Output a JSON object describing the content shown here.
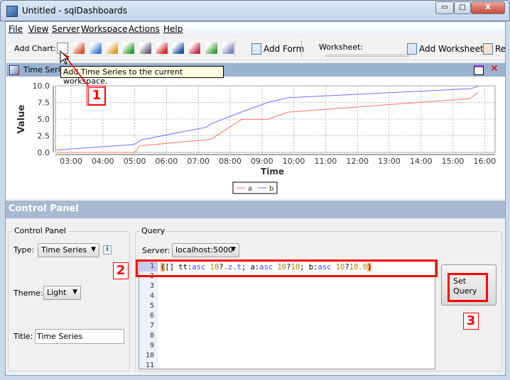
{
  "window": {
    "title": "Untitled - sqlDashboards",
    "min": "▭",
    "max": "□",
    "close": "X"
  },
  "menu": [
    "File",
    "View",
    "Server",
    "Workspace",
    "Actions",
    "Help"
  ],
  "toolbar": {
    "add_chart_label": "Add Chart:",
    "chart_icons": [
      "time-series-icon",
      "area-chart-icon",
      "bar-chart-icon",
      "bubble-chart-icon",
      "candlestick-icon",
      "table-icon",
      "heatmap-icon",
      "histogram-icon",
      "line-chart-icon",
      "pie-chart-icon",
      "scatter-icon"
    ],
    "add_form": "Add Form",
    "worksheet_label": "Worksheet:",
    "add_worksheet": "Add Worksheet",
    "remove": "Rem"
  },
  "tooltip": "Add Time Series to the current workspace.",
  "internal_frame": {
    "title": "Time Series"
  },
  "annotations": [
    "1",
    "2",
    "3"
  ],
  "chart_data": {
    "type": "line",
    "xlabel": "Time",
    "ylabel": "Value",
    "ylim": [
      0,
      10
    ],
    "yticks": [
      "0.0",
      "2.5",
      "5.0",
      "7.5",
      "10.0"
    ],
    "xticks": [
      "03:00",
      "04:00",
      "05:00",
      "06:00",
      "07:00",
      "08:00",
      "09:00",
      "10:00",
      "11:00",
      "12:00",
      "13:00",
      "14:00",
      "15:00",
      "16:00"
    ],
    "grid": true,
    "legend": "bottom",
    "series": [
      {
        "name": "a",
        "color": "#ff7070",
        "points": [
          [
            "02:33",
            0
          ],
          [
            "05:00",
            0
          ],
          [
            "05:10",
            1.0
          ],
          [
            "07:23",
            1.96
          ],
          [
            "08:22",
            4.96
          ],
          [
            "09:11",
            4.96
          ],
          [
            "09:48",
            6.04
          ],
          [
            "15:32",
            8.07
          ],
          [
            "15:48",
            9.04
          ]
        ]
      },
      {
        "name": "b",
        "color": "#7070ff",
        "points": [
          [
            "02:33",
            0.36
          ],
          [
            "05:00",
            1.2
          ],
          [
            "05:11",
            1.86
          ],
          [
            "07:15",
            3.79
          ],
          [
            "07:23",
            4.25
          ],
          [
            "08:19",
            6.0
          ],
          [
            "09:11",
            7.5
          ],
          [
            "09:48",
            8.2
          ],
          [
            "15:34",
            9.57
          ],
          [
            "15:48",
            9.93
          ]
        ]
      }
    ]
  },
  "control_panel": {
    "header": "Control Panel",
    "group_title": "Control Panel",
    "type_label": "Type:",
    "type_value": "Time Series",
    "theme_label": "Theme:",
    "theme_value": "Light",
    "title_label": "Title:",
    "title_value": "Time Series"
  },
  "query": {
    "group_title": "Query",
    "server_label": "Server:",
    "server_value": "localhost:5000",
    "line_numbers": [
      "1",
      "2",
      "3",
      "4",
      "5",
      "6",
      "7",
      "8",
      "9",
      "10",
      "11"
    ],
    "code_tokens": [
      {
        "t": "(",
        "c": "#000",
        "bg": "#f5b070"
      },
      {
        "t": "[] tt:",
        "c": "#000"
      },
      {
        "t": "asc",
        "c": "#4040ff"
      },
      {
        "t": " ",
        "c": "#000"
      },
      {
        "t": "10",
        "c": "#b08000"
      },
      {
        "t": "?",
        "c": "#000"
      },
      {
        "t": ".z.t",
        "c": "#4040ff"
      },
      {
        "t": "; a:",
        "c": "#000"
      },
      {
        "t": "asc",
        "c": "#4040ff"
      },
      {
        "t": " ",
        "c": "#000"
      },
      {
        "t": "10",
        "c": "#b08000"
      },
      {
        "t": "?",
        "c": "#000"
      },
      {
        "t": "10",
        "c": "#b08000"
      },
      {
        "t": "; b:",
        "c": "#000"
      },
      {
        "t": "asc",
        "c": "#4040ff"
      },
      {
        "t": " ",
        "c": "#000"
      },
      {
        "t": "10",
        "c": "#b08000"
      },
      {
        "t": "?",
        "c": "#000"
      },
      {
        "t": "10.0",
        "c": "#b08000"
      },
      {
        "t": ")",
        "c": "#000",
        "bg": "#f5b070"
      }
    ],
    "set_query": "Set Query"
  }
}
